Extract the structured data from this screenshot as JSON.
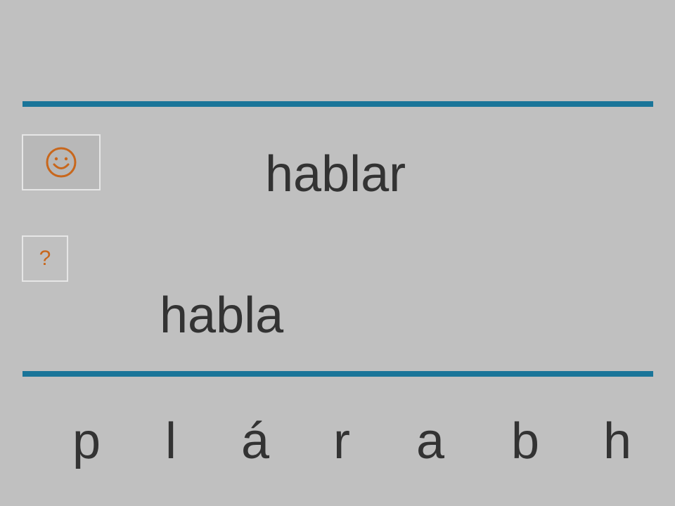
{
  "target_word": "hablar",
  "attempt_word": "habla",
  "hint_label": "?",
  "icons": {
    "feedback": "smiley-face-icon"
  },
  "colors": {
    "background": "#c0c0c0",
    "rule": "#1a7599",
    "text": "#333333",
    "accent": "#c8671c"
  },
  "letters": [
    "p",
    "l",
    "á",
    "r",
    "a",
    "b",
    "h"
  ]
}
